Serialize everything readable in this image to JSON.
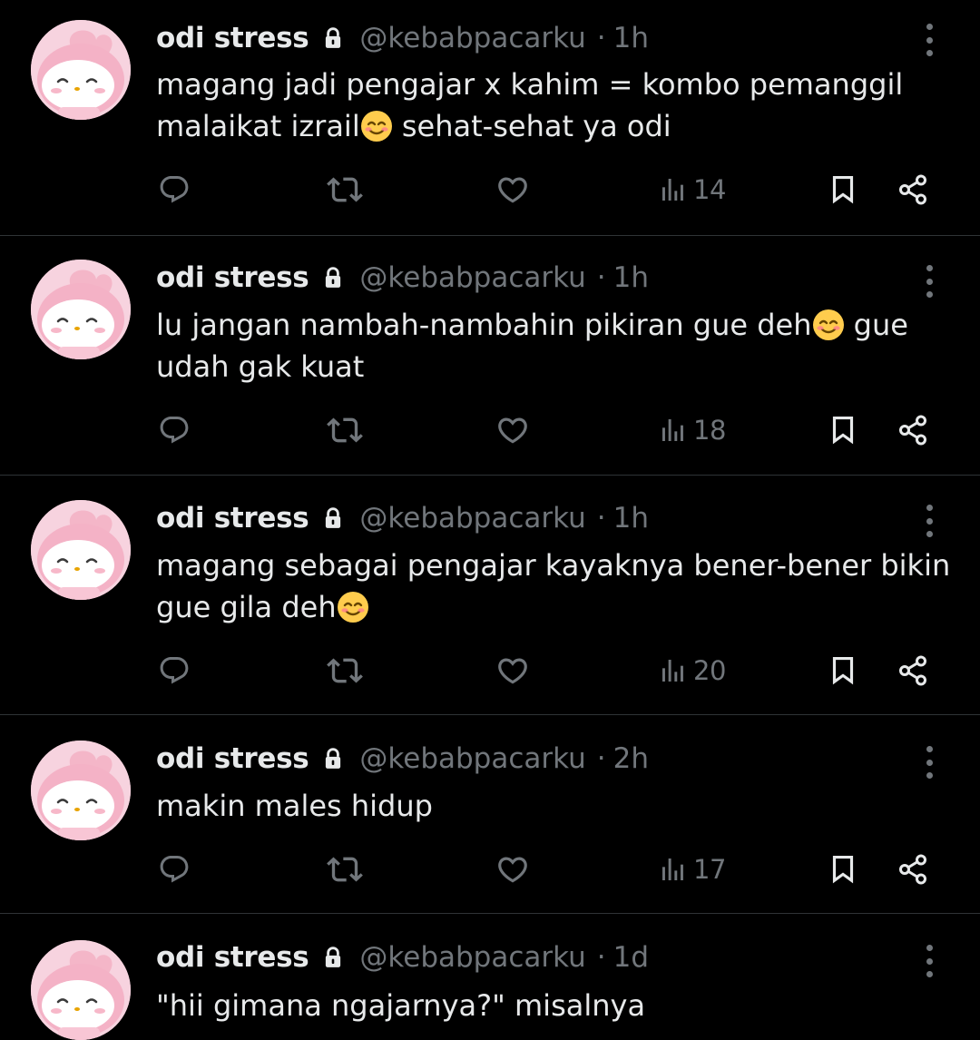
{
  "colors": {
    "background": "#000000",
    "text_primary": "#e7e9ea",
    "text_secondary": "#71767b",
    "divider": "#2f3336",
    "avatar_pink": "#f7d3df"
  },
  "icons": {
    "avatar": "pink-bunny-character-avatar",
    "lock": "lock-icon",
    "more": "more-vertical-icon",
    "reply": "reply-bubble-icon",
    "repost": "repost-icon",
    "like": "heart-icon",
    "views": "views-bar-icon",
    "bookmark": "bookmark-icon",
    "share": "share-icon",
    "emoji": "smiling-face-emoji"
  },
  "tweets": [
    {
      "name": "odi stress",
      "handle": "@kebabpacarku",
      "separator": "·",
      "time": "1h",
      "text_parts": [
        "magang jadi pengajar x kahim = kombo pemanggil\nmalaikat izrail",
        " sehat-sehat ya odi"
      ],
      "views": "14"
    },
    {
      "name": "odi stress",
      "handle": "@kebabpacarku",
      "separator": "·",
      "time": "1h",
      "text_parts": [
        "lu jangan nambah-nambahin pikiran gue deh",
        " gue\nudah gak kuat"
      ],
      "views": "18"
    },
    {
      "name": "odi stress",
      "handle": "@kebabpacarku",
      "separator": "·",
      "time": "1h",
      "text_parts": [
        "magang sebagai pengajar kayaknya bener-bener bikin\ngue gila deh",
        ""
      ],
      "views": "20"
    },
    {
      "name": "odi stress",
      "handle": "@kebabpacarku",
      "separator": "·",
      "time": "2h",
      "text_parts": [
        "makin males hidup"
      ],
      "views": "17"
    },
    {
      "name": "odi stress",
      "handle": "@kebabpacarku",
      "separator": "·",
      "time": "1d",
      "text_parts": [
        "\"hii gimana ngajarnya?\" misalnya"
      ],
      "views": ""
    }
  ]
}
